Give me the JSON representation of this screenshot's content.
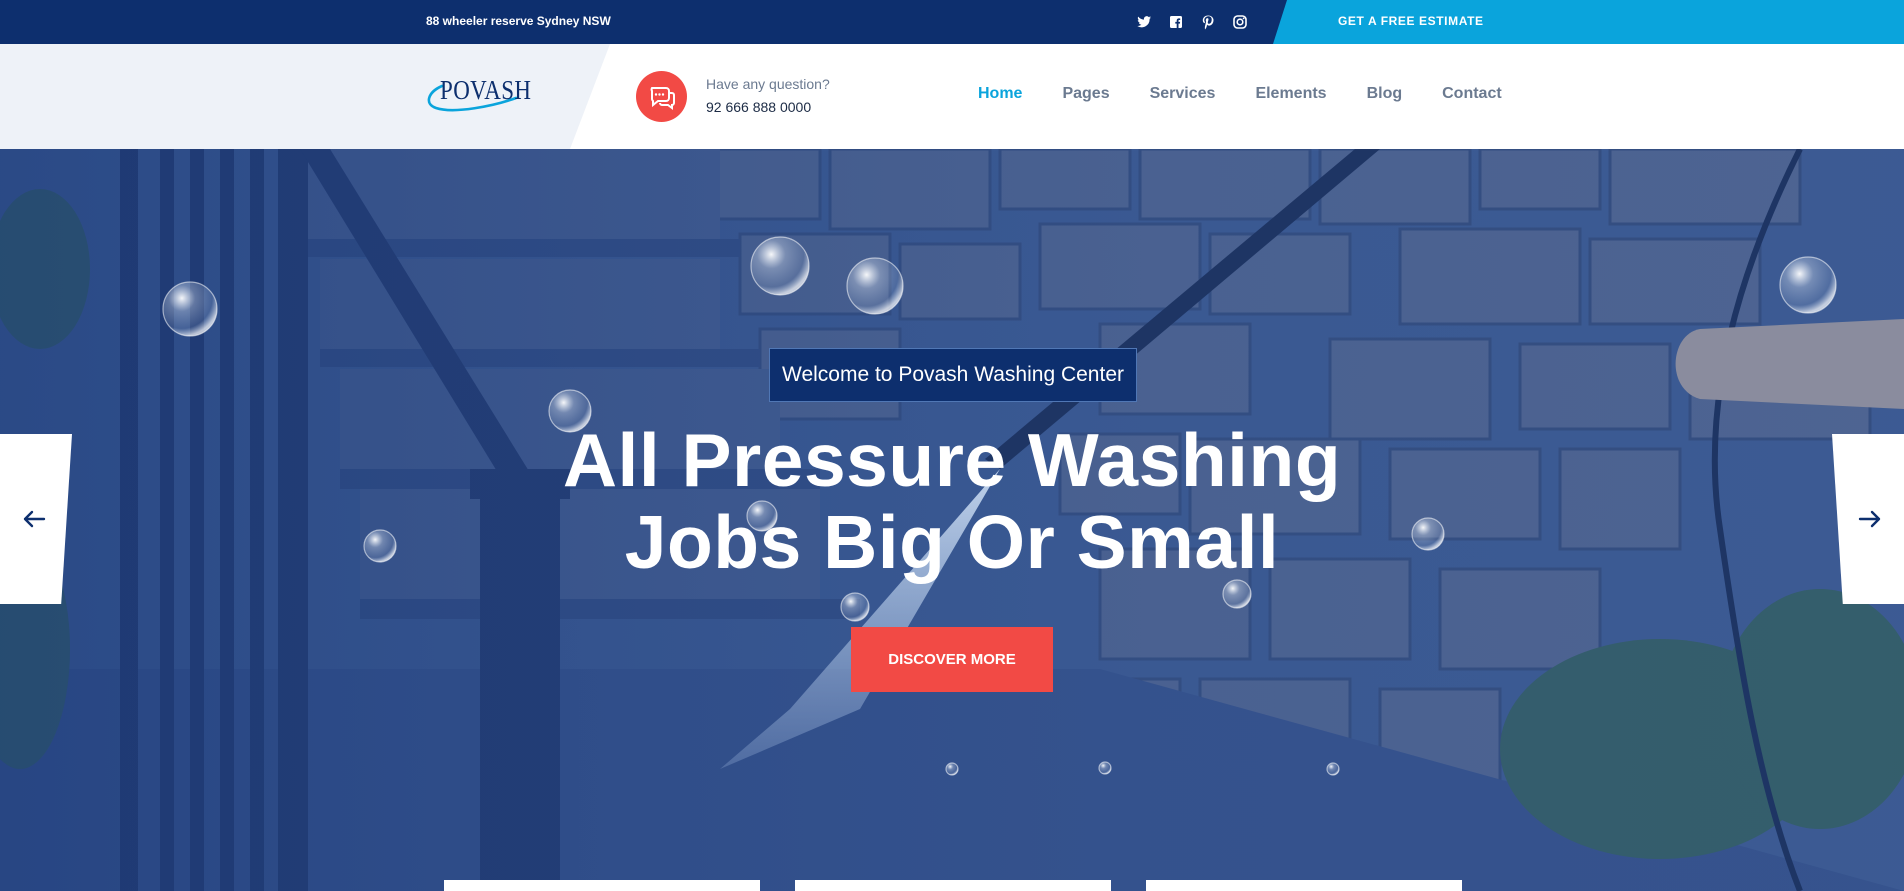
{
  "topbar": {
    "address": "88 wheeler reserve Sydney NSW",
    "social_icons": [
      "twitter-icon",
      "facebook-icon",
      "pinterest-icon",
      "instagram-icon"
    ],
    "estimate_label": "GET A FREE ESTIMATE"
  },
  "header": {
    "logo_text": "POVASH",
    "question_label": "Have any question?",
    "phone": "92 666 888 0000",
    "nav": [
      "Home",
      "Pages",
      "Services",
      "Elements",
      "Blog",
      "Contact"
    ],
    "active_nav": "Home"
  },
  "hero": {
    "badge": "Welcome to Povash Washing Center",
    "headline_line1": "All Pressure Washing",
    "headline_line2": "Jobs Big Or Small",
    "cta": "DISCOVER MORE"
  },
  "colors": {
    "navy": "#0d2f6e",
    "accent_blue": "#0aa4dc",
    "accent_red": "#f24a45"
  }
}
